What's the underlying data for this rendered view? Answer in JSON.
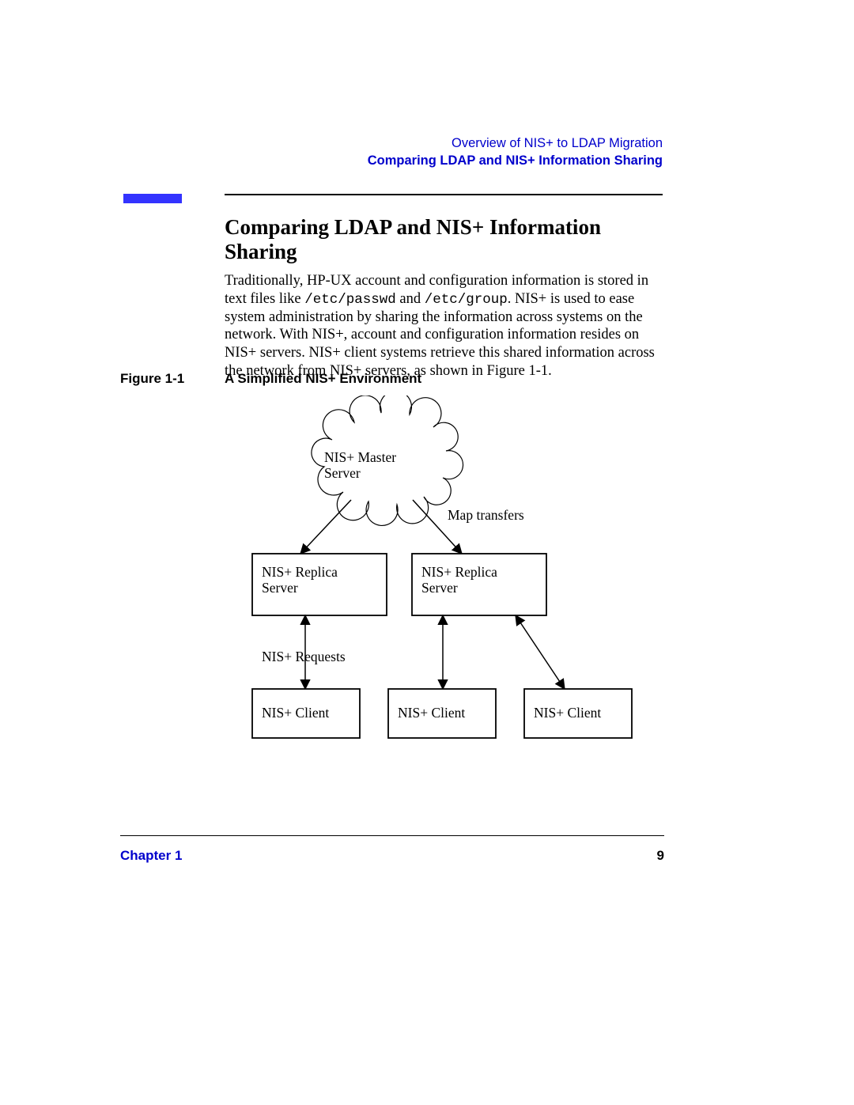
{
  "header": {
    "breadcrumb": "Overview of NIS+ to LDAP Migration",
    "section": "Comparing LDAP and NIS+ Information Sharing"
  },
  "title": "Comparing LDAP and NIS+ Information Sharing",
  "body": {
    "part1": "Traditionally, HP-UX account and configuration information is stored in text files like ",
    "code1": "/etc/passwd",
    "part2": " and ",
    "code2": "/etc/group",
    "part3": ". NIS+ is used to ease system administration by sharing the information across systems on the network. With NIS+, account and configuration information resides on NIS+ servers. NIS+ client systems retrieve this shared information across the network from NIS+ servers, as shown in Figure 1-1."
  },
  "figure": {
    "label": "Figure 1-1",
    "caption": "A Simplified NIS+ Environment"
  },
  "diagram": {
    "master": "NIS+ Master Server",
    "map_transfers": "Map transfers",
    "replica": "NIS+ Replica Server",
    "requests": "NIS+ Requests",
    "client": "NIS+ Client"
  },
  "footer": {
    "chapter": "Chapter 1",
    "page": "9"
  }
}
